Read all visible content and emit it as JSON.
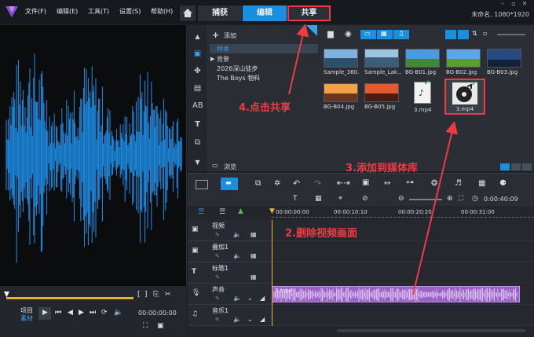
{
  "app": {
    "filename": "未命名, 1080*1920",
    "menu": [
      "文件(F)",
      "编辑(E)",
      "工具(T)",
      "设置(S)",
      "帮助(H)"
    ],
    "mode_tabs": [
      "捕获",
      "编辑",
      "共享"
    ],
    "active_mode": "编辑"
  },
  "library": {
    "add_label": "添加",
    "folders": [
      "样本",
      "背景",
      "2026深山徒步",
      "The Boys 物料"
    ],
    "browse_label": "浏览",
    "media": [
      {
        "name": "Sample_360...",
        "thumb": "#3a6b8e"
      },
      {
        "name": "Sample_Lak...",
        "thumb": "#5b7fa8"
      },
      {
        "name": "BG-B01.jpg",
        "thumb": "#3f86c7"
      },
      {
        "name": "BG-B02.jpg",
        "thumb": "#4d94d6"
      },
      {
        "name": "BG-B03.jpg",
        "thumb": "#1f3a66"
      },
      {
        "name": "BG-B04.jpg",
        "thumb": "#d2693a"
      },
      {
        "name": "BG-B05.jpg",
        "thumb": "#c24a2a"
      },
      {
        "name": "3.mp4",
        "thumb": "#f2f2f2"
      },
      {
        "name": "3.mp4",
        "thumb": "#444a52"
      }
    ]
  },
  "player": {
    "project_label": "项目",
    "clip_label": "素材",
    "timecode": "00:00:00:00"
  },
  "timeline": {
    "ruler": [
      "00:00:00:00",
      "00:00:10:10",
      "00:00:20:20",
      "00:00:31:00"
    ],
    "timecode": "0:00:40:09",
    "tracks": [
      "视频",
      "叠加1",
      "标题1",
      "声音",
      "音乐1"
    ],
    "audio_clip": "3.mp4"
  },
  "annotations": {
    "step2": "2.删除视频画面",
    "step3": "3.添加到媒体库",
    "step4": "4.点击共享"
  },
  "colors": {
    "accent": "#1a8fe0",
    "annotation": "#ef3b45",
    "waveform": "#1e90ea",
    "audio_clip": "#9a5fc8"
  }
}
